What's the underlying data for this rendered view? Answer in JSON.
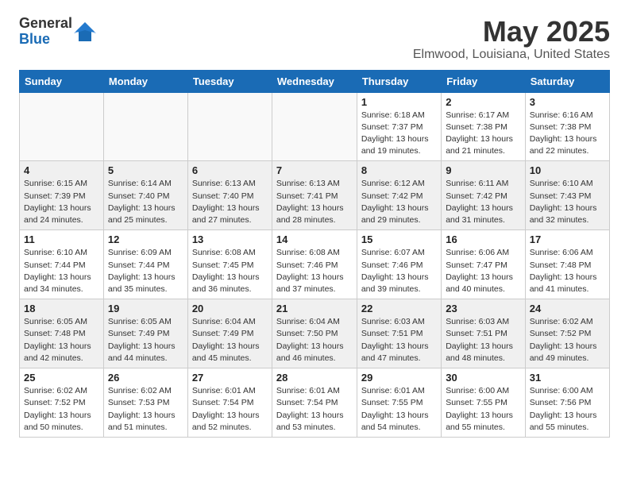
{
  "header": {
    "logo_general": "General",
    "logo_blue": "Blue",
    "title": "May 2025",
    "subtitle": "Elmwood, Louisiana, United States"
  },
  "weekdays": [
    "Sunday",
    "Monday",
    "Tuesday",
    "Wednesday",
    "Thursday",
    "Friday",
    "Saturday"
  ],
  "weeks": [
    [
      {
        "day": "",
        "info": ""
      },
      {
        "day": "",
        "info": ""
      },
      {
        "day": "",
        "info": ""
      },
      {
        "day": "",
        "info": ""
      },
      {
        "day": "1",
        "info": "Sunrise: 6:18 AM\nSunset: 7:37 PM\nDaylight: 13 hours\nand 19 minutes."
      },
      {
        "day": "2",
        "info": "Sunrise: 6:17 AM\nSunset: 7:38 PM\nDaylight: 13 hours\nand 21 minutes."
      },
      {
        "day": "3",
        "info": "Sunrise: 6:16 AM\nSunset: 7:38 PM\nDaylight: 13 hours\nand 22 minutes."
      }
    ],
    [
      {
        "day": "4",
        "info": "Sunrise: 6:15 AM\nSunset: 7:39 PM\nDaylight: 13 hours\nand 24 minutes."
      },
      {
        "day": "5",
        "info": "Sunrise: 6:14 AM\nSunset: 7:40 PM\nDaylight: 13 hours\nand 25 minutes."
      },
      {
        "day": "6",
        "info": "Sunrise: 6:13 AM\nSunset: 7:40 PM\nDaylight: 13 hours\nand 27 minutes."
      },
      {
        "day": "7",
        "info": "Sunrise: 6:13 AM\nSunset: 7:41 PM\nDaylight: 13 hours\nand 28 minutes."
      },
      {
        "day": "8",
        "info": "Sunrise: 6:12 AM\nSunset: 7:42 PM\nDaylight: 13 hours\nand 29 minutes."
      },
      {
        "day": "9",
        "info": "Sunrise: 6:11 AM\nSunset: 7:42 PM\nDaylight: 13 hours\nand 31 minutes."
      },
      {
        "day": "10",
        "info": "Sunrise: 6:10 AM\nSunset: 7:43 PM\nDaylight: 13 hours\nand 32 minutes."
      }
    ],
    [
      {
        "day": "11",
        "info": "Sunrise: 6:10 AM\nSunset: 7:44 PM\nDaylight: 13 hours\nand 34 minutes."
      },
      {
        "day": "12",
        "info": "Sunrise: 6:09 AM\nSunset: 7:44 PM\nDaylight: 13 hours\nand 35 minutes."
      },
      {
        "day": "13",
        "info": "Sunrise: 6:08 AM\nSunset: 7:45 PM\nDaylight: 13 hours\nand 36 minutes."
      },
      {
        "day": "14",
        "info": "Sunrise: 6:08 AM\nSunset: 7:46 PM\nDaylight: 13 hours\nand 37 minutes."
      },
      {
        "day": "15",
        "info": "Sunrise: 6:07 AM\nSunset: 7:46 PM\nDaylight: 13 hours\nand 39 minutes."
      },
      {
        "day": "16",
        "info": "Sunrise: 6:06 AM\nSunset: 7:47 PM\nDaylight: 13 hours\nand 40 minutes."
      },
      {
        "day": "17",
        "info": "Sunrise: 6:06 AM\nSunset: 7:48 PM\nDaylight: 13 hours\nand 41 minutes."
      }
    ],
    [
      {
        "day": "18",
        "info": "Sunrise: 6:05 AM\nSunset: 7:48 PM\nDaylight: 13 hours\nand 42 minutes."
      },
      {
        "day": "19",
        "info": "Sunrise: 6:05 AM\nSunset: 7:49 PM\nDaylight: 13 hours\nand 44 minutes."
      },
      {
        "day": "20",
        "info": "Sunrise: 6:04 AM\nSunset: 7:49 PM\nDaylight: 13 hours\nand 45 minutes."
      },
      {
        "day": "21",
        "info": "Sunrise: 6:04 AM\nSunset: 7:50 PM\nDaylight: 13 hours\nand 46 minutes."
      },
      {
        "day": "22",
        "info": "Sunrise: 6:03 AM\nSunset: 7:51 PM\nDaylight: 13 hours\nand 47 minutes."
      },
      {
        "day": "23",
        "info": "Sunrise: 6:03 AM\nSunset: 7:51 PM\nDaylight: 13 hours\nand 48 minutes."
      },
      {
        "day": "24",
        "info": "Sunrise: 6:02 AM\nSunset: 7:52 PM\nDaylight: 13 hours\nand 49 minutes."
      }
    ],
    [
      {
        "day": "25",
        "info": "Sunrise: 6:02 AM\nSunset: 7:52 PM\nDaylight: 13 hours\nand 50 minutes."
      },
      {
        "day": "26",
        "info": "Sunrise: 6:02 AM\nSunset: 7:53 PM\nDaylight: 13 hours\nand 51 minutes."
      },
      {
        "day": "27",
        "info": "Sunrise: 6:01 AM\nSunset: 7:54 PM\nDaylight: 13 hours\nand 52 minutes."
      },
      {
        "day": "28",
        "info": "Sunrise: 6:01 AM\nSunset: 7:54 PM\nDaylight: 13 hours\nand 53 minutes."
      },
      {
        "day": "29",
        "info": "Sunrise: 6:01 AM\nSunset: 7:55 PM\nDaylight: 13 hours\nand 54 minutes."
      },
      {
        "day": "30",
        "info": "Sunrise: 6:00 AM\nSunset: 7:55 PM\nDaylight: 13 hours\nand 55 minutes."
      },
      {
        "day": "31",
        "info": "Sunrise: 6:00 AM\nSunset: 7:56 PM\nDaylight: 13 hours\nand 55 minutes."
      }
    ]
  ]
}
